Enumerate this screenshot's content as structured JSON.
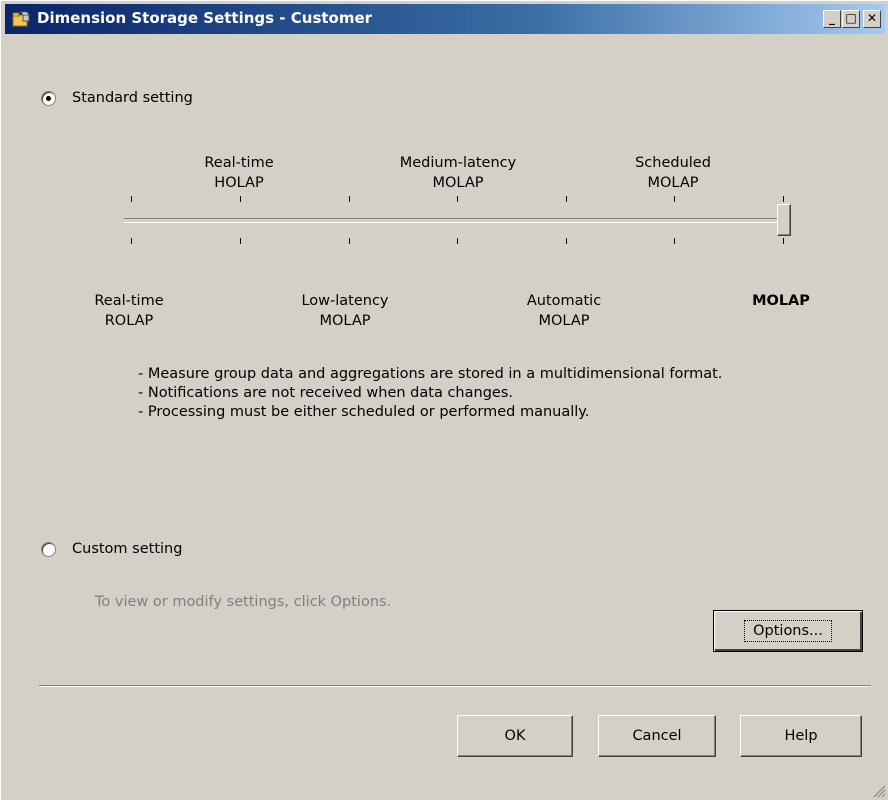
{
  "window": {
    "title": "Dimension Storage Settings - Customer",
    "controls": {
      "minimize": "_",
      "maximize": "□",
      "close": "✕"
    }
  },
  "standard": {
    "label": "Standard setting",
    "selected": true,
    "slider": {
      "top_labels": [
        {
          "line1": "Real-time",
          "line2": "HOLAP"
        },
        {
          "line1": "Medium-latency",
          "line2": "MOLAP"
        },
        {
          "line1": "Scheduled",
          "line2": "MOLAP"
        }
      ],
      "bottom_labels": [
        {
          "line1": "Real-time",
          "line2": "ROLAP"
        },
        {
          "line1": "Low-latency",
          "line2": "MOLAP"
        },
        {
          "line1": "Automatic",
          "line2": "MOLAP"
        },
        {
          "line1": "MOLAP",
          "line2": ""
        }
      ],
      "selected_value": "MOLAP"
    },
    "description": [
      "- Measure group data and aggregations are stored in a multidimensional format.",
      "- Notifications are not received when data changes.",
      "- Processing must be either scheduled or performed manually."
    ]
  },
  "custom": {
    "label": "Custom setting",
    "selected": false,
    "hint": "To view or modify settings, click Options.",
    "options_button": "Options..."
  },
  "footer": {
    "ok": "OK",
    "cancel": "Cancel",
    "help": "Help"
  },
  "colors": {
    "dialog_bg": "#d4d0c8",
    "titlebar_start": "#0a246a",
    "titlebar_end": "#a6caf0",
    "disabled_text": "#808080"
  }
}
